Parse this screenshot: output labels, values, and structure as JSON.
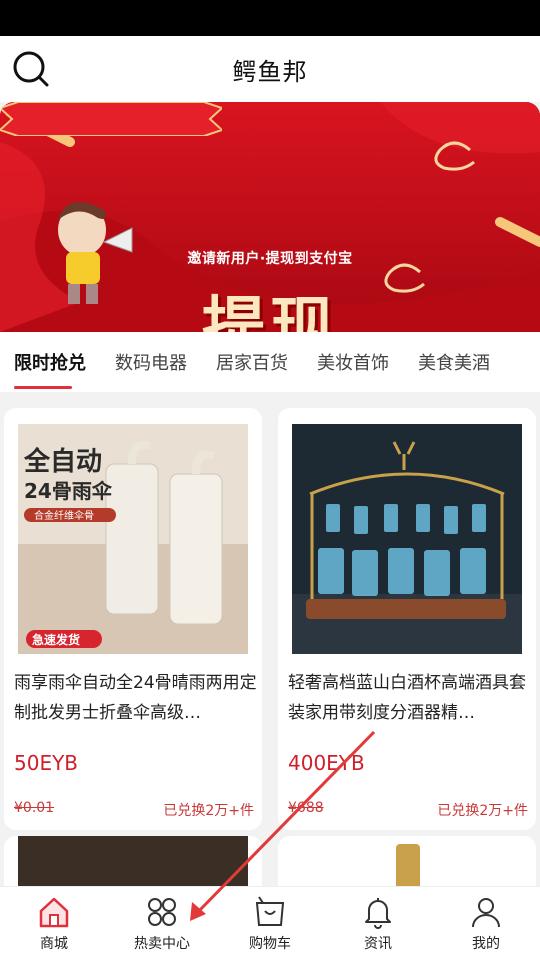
{
  "app": {
    "title": "鳄鱼邦"
  },
  "banner": {
    "ribbon_text": "邀请新用户·提现到支付宝",
    "headline": "提现"
  },
  "tabs": [
    "限时抢兑",
    "数码电器",
    "居家百货",
    "美妆首饰",
    "美食美酒"
  ],
  "products": [
    {
      "title": "雨享雨伞自动全24骨晴雨两用定制批发男士折叠伞高级…",
      "price": "50EYB",
      "old_price": "¥0.01",
      "sold": "已兑换2万+件",
      "img_title": "全自动",
      "img_sub": "24骨雨伞",
      "img_tag": "合金纤维伞骨",
      "img_badge": "急速发货"
    },
    {
      "title": "轻奢高档蓝山白酒杯高端酒具套装家用带刻度分酒器精…",
      "price": "400EYB",
      "old_price": "¥688",
      "sold": "已兑换2万+件"
    }
  ],
  "nav": [
    {
      "label": "商城",
      "icon": "home-icon"
    },
    {
      "label": "热卖中心",
      "icon": "grid-icon"
    },
    {
      "label": "购物车",
      "icon": "cart-icon"
    },
    {
      "label": "资讯",
      "icon": "bell-icon"
    },
    {
      "label": "我的",
      "icon": "user-icon"
    }
  ],
  "colors": {
    "accent": "#e0303a",
    "banner_red": "#c8101a",
    "price_red": "#d0202c"
  }
}
